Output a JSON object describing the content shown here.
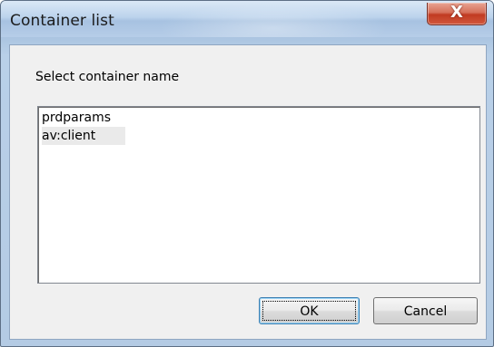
{
  "window": {
    "title": "Container list",
    "close_icon": "close-icon",
    "close_glyph": "X"
  },
  "dialog": {
    "prompt": "Select container name",
    "list": {
      "items": [
        {
          "label": "prdparams",
          "selected": false
        },
        {
          "label": "av:client",
          "selected": true
        }
      ]
    },
    "buttons": {
      "ok_label": "OK",
      "cancel_label": "Cancel"
    }
  },
  "colors": {
    "titlebar": "#b9d0e8",
    "close_button": "#c13b22",
    "client_background": "#f0f0f0",
    "selection_highlight": "#eaeaea"
  }
}
